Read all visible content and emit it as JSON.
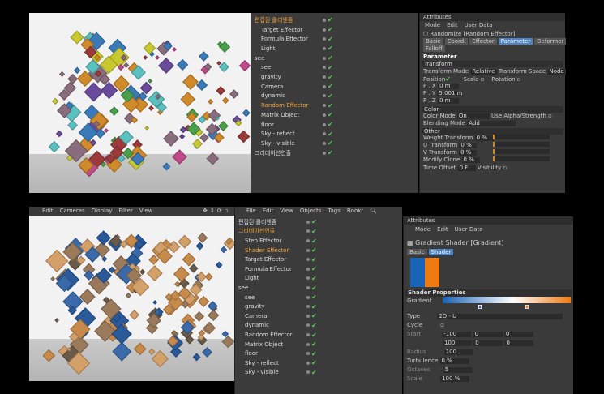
{
  "top": {
    "objects": [
      {
        "name": "편집된 클리앤줌",
        "sel": true,
        "indent": 0
      },
      {
        "name": "Target Effector",
        "indent": 1
      },
      {
        "name": "Formula Effector",
        "indent": 1
      },
      {
        "name": "Light",
        "indent": 1
      },
      {
        "name": "see",
        "indent": 0
      },
      {
        "name": "see",
        "indent": 1
      },
      {
        "name": "gravity",
        "indent": 1
      },
      {
        "name": "Camera",
        "indent": 1
      },
      {
        "name": "dynamic",
        "indent": 1
      },
      {
        "name": "Random Effector",
        "sel": true,
        "indent": 1
      },
      {
        "name": "Matrix Object",
        "indent": 1
      },
      {
        "name": "floor",
        "indent": 1
      },
      {
        "name": "Sky - reflect",
        "indent": 1
      },
      {
        "name": "Sky - visible",
        "indent": 1
      },
      {
        "name": "그리데이션연출",
        "indent": 0
      }
    ],
    "attr": {
      "title": "Attributes",
      "menu": [
        "Mode",
        "Edit",
        "User Data"
      ],
      "object_label": "Randomize [Random Effector]",
      "tabs": [
        "Basic",
        "Coord.",
        "Effector",
        "Parameter",
        "Deformer"
      ],
      "tab2": "Falloff",
      "active_tab": "Parameter",
      "section": "Parameter",
      "transform": "Transform",
      "transform_mode_label": "Transform Mode",
      "transform_mode": "Relative",
      "transform_space_label": "Transform Space",
      "transform_space": "Node",
      "position": "Position",
      "scale": "Scale",
      "rotation": "Rotation",
      "px": "P . X",
      "px_val": "0 m",
      "py": "P . Y",
      "py_val": "5.001 m",
      "pz": "P . Z",
      "pz_val": "0 m",
      "color": "Color",
      "color_mode_label": "Color Mode",
      "color_mode": "On",
      "use_alpha": "Use Alpha/Strength",
      "blending_label": "Blending Mode",
      "blending": "Add",
      "other": "Other",
      "weight": "Weight Transform",
      "weight_val": "0 %",
      "utrans": "U Transform",
      "utrans_val": "0 %",
      "vtrans": "V Transform",
      "vtrans_val": "0 %",
      "modclone": "Modify Clone",
      "modclone_val": "0 %",
      "timeoffset": "Time Offset",
      "timeoffset_val": "0 F",
      "visibility": "Visibility"
    }
  },
  "bottom": {
    "viewport_menu": [
      "Edit",
      "Cameras",
      "Display",
      "Filter",
      "View"
    ],
    "om_menu": [
      "File",
      "Edit",
      "View",
      "Objects",
      "Tags",
      "Bookr"
    ],
    "objects": [
      {
        "name": "편집된 클리앤줌",
        "indent": 0
      },
      {
        "name": "그리데이션연출",
        "sel": true,
        "indent": 0
      },
      {
        "name": "Step Effector",
        "indent": 1
      },
      {
        "name": "Shader Effector",
        "sel": true,
        "indent": 1
      },
      {
        "name": "Target Effector",
        "indent": 1
      },
      {
        "name": "Formula Effector",
        "indent": 1
      },
      {
        "name": "Light",
        "indent": 1
      },
      {
        "name": "see",
        "indent": 0
      },
      {
        "name": "see",
        "indent": 1
      },
      {
        "name": "gravity",
        "indent": 1
      },
      {
        "name": "Camera",
        "indent": 1
      },
      {
        "name": "dynamic",
        "indent": 1
      },
      {
        "name": "Random Effector",
        "indent": 1
      },
      {
        "name": "Matrix Object",
        "indent": 1
      },
      {
        "name": "floor",
        "indent": 1
      },
      {
        "name": "Sky - reflect",
        "indent": 1
      },
      {
        "name": "Sky - visible",
        "indent": 1
      }
    ],
    "attr": {
      "title": "Attributes",
      "menu": [
        "Mode",
        "Edit",
        "User Data"
      ],
      "object_label": "Gradient Shader [Gradient]",
      "tabs": [
        "Basic",
        "Shader"
      ],
      "active_tab": "Shader",
      "section": "Shader Properties",
      "gradient": "Gradient",
      "type_label": "Type",
      "type_val": "2D - U",
      "cycle": "Cycle",
      "start": "Start",
      "start_val": "-100",
      "end_val": "100",
      "radius": "Radius",
      "radius_val": "100",
      "turbulence": "Turbulence",
      "turbulence_val": "0 %",
      "octaves": "Octaves",
      "octaves_val": "5",
      "scale": "Scale",
      "scale_val": "100 %",
      "zero": "0"
    }
  }
}
